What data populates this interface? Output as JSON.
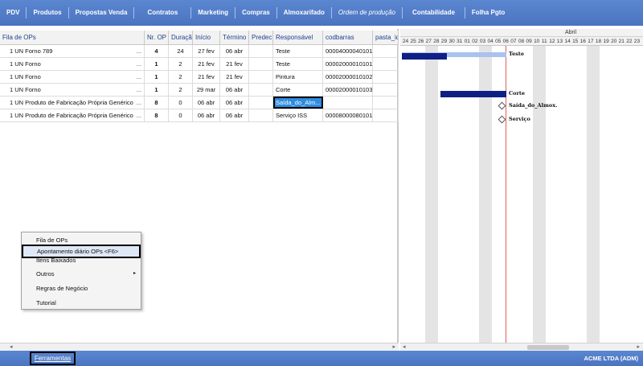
{
  "menu": [
    "PDV",
    "Produtos",
    "Propostas Venda",
    "Contratos",
    "Marketing",
    "Compras",
    "Almoxarifado",
    "Ordem de produção",
    "Contabilidade",
    "Folha Pgto"
  ],
  "grid": {
    "columns": [
      "Fila de OPs",
      "Nr. OP",
      "Duração",
      "Início",
      "Término",
      "Predec.",
      "Responsável",
      "codbarras",
      "pasta_id"
    ],
    "rows": [
      {
        "name": "1 UN Forno 789",
        "op": "4",
        "dur": "24",
        "ini": "27 fev",
        "ter": "06 abr",
        "pre": "",
        "resp": "Teste",
        "cod": "00004000040101"
      },
      {
        "name": "1 UN Forno",
        "op": "1",
        "dur": "2",
        "ini": "21 fev",
        "ter": "21 fev",
        "pre": "",
        "resp": "Teste",
        "cod": "00002000010101"
      },
      {
        "name": "1 UN Forno",
        "op": "1",
        "dur": "2",
        "ini": "21 fev",
        "ter": "21 fev",
        "pre": "",
        "resp": "Pintura",
        "cod": "00002000010102"
      },
      {
        "name": "1 UN Forno",
        "op": "1",
        "dur": "2",
        "ini": "29 mar",
        "ter": "06 abr",
        "pre": "",
        "resp": "Corte",
        "cod": "00002000010103"
      },
      {
        "name": "1 UN Produto de Fabricação Própria Genérico",
        "op": "8",
        "dur": "0",
        "ini": "06 abr",
        "ter": "06 abr",
        "pre": "",
        "resp": "Saída_do_Alm...",
        "cod": ""
      },
      {
        "name": "1 UN Produto de Fabricação Própria Genérico",
        "op": "8",
        "dur": "0",
        "ini": "06 abr",
        "ter": "06 abr",
        "pre": "",
        "resp": "Serviço ISS",
        "cod": "00008000080101"
      }
    ],
    "dots": "..."
  },
  "gantt": {
    "month": "Abril",
    "days": [
      "24",
      "25",
      "26",
      "27",
      "28",
      "29",
      "30",
      "31",
      "01",
      "02",
      "03",
      "04",
      "05",
      "06",
      "07",
      "08",
      "09",
      "10",
      "11",
      "12",
      "13",
      "14",
      "15",
      "16",
      "17",
      "18",
      "19",
      "20",
      "21",
      "22",
      "23"
    ],
    "labels": [
      "Teste",
      "Corte",
      "Saída_do_Almox.",
      "Serviço"
    ]
  },
  "context_menu": {
    "items": [
      "Fila de OPs",
      "Apontamento diário OPs <F6>",
      "Itens Baixados",
      "Outros",
      "Regras de Negócio",
      "Tutorial"
    ],
    "submenu_arrow": "▸"
  },
  "bottom": {
    "tools": "Ferramentas",
    "company": "ACME LTDA (ADM)"
  },
  "colors": {
    "bar": "#4a74c0",
    "selection": "#2e8de0",
    "gantt_bar": "#0e1f85"
  }
}
